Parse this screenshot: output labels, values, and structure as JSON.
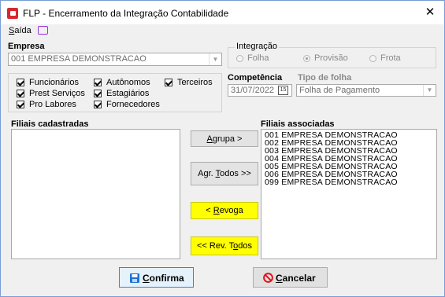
{
  "window": {
    "title": "FLP - Encerramento da Integração Contabilidade",
    "close_glyph": "✕"
  },
  "menu": {
    "saida_prefix": "S",
    "saida_rest": "aída",
    "icon": "monitor-icon"
  },
  "empresa": {
    "label": "Empresa",
    "value": "001 EMPRESA DEMONSTRACAO"
  },
  "integracao": {
    "label": "Integração",
    "options": [
      {
        "label": "Folha",
        "selected": false
      },
      {
        "label": "Provisão",
        "selected": true
      },
      {
        "label": "Frota",
        "selected": false
      }
    ]
  },
  "checkboxes": [
    {
      "label": "Funcionários",
      "checked": true
    },
    {
      "label": "Autônomos",
      "checked": true
    },
    {
      "label": "Terceiros",
      "checked": true
    },
    {
      "label": "Prest Serviços",
      "checked": true
    },
    {
      "label": "Estagiários",
      "checked": true
    },
    {
      "label": "Pro Labores",
      "checked": true
    },
    {
      "label": "Fornecedores",
      "checked": true
    }
  ],
  "competencia": {
    "label": "Competência",
    "value": "31/07/2022",
    "calendar_glyph": "15"
  },
  "tipo_folha": {
    "label": "Tipo de folha",
    "value": "Folha de Pagamento"
  },
  "filiais_cadastradas": {
    "label": "Filiais cadastradas",
    "items": []
  },
  "filiais_associadas": {
    "label": "Filiais associadas",
    "items": [
      "001 EMPRESA DEMONSTRACAO",
      "002 EMPRESA DEMONSTRACAO",
      "003 EMPRESA DEMONSTRACAO",
      "004 EMPRESA DEMONSTRACAO",
      "005 EMPRESA DEMONSTRACAO",
      "006 EMPRESA DEMONSTRACAO",
      "099 EMPRESA DEMONSTRACAO"
    ]
  },
  "buttons": {
    "agrupa": {
      "pre": "",
      "u": "A",
      "post": "grupa >"
    },
    "agr_todos": {
      "pre": "Agr. ",
      "u": "T",
      "post": "odos >>"
    },
    "revoga": {
      "pre": "< ",
      "u": "R",
      "post": "evoga"
    },
    "rev_todos": {
      "pre": "<< Rev. T",
      "u": "o",
      "post": "dos"
    },
    "confirma": {
      "pre": "",
      "u": "C",
      "post": "onfirma"
    },
    "cancelar": {
      "pre": "",
      "u": "C",
      "post": "ancelar"
    }
  },
  "colors": {
    "accent_yellow": "#ffff00",
    "confirm_blue": "#1e73d2",
    "cancel_red": "#e0141e"
  }
}
